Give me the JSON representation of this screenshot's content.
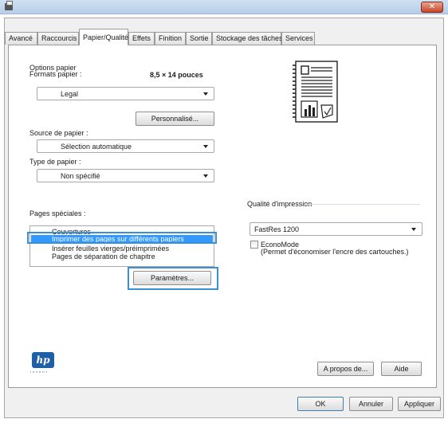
{
  "window": {
    "close_glyph": "✕"
  },
  "tabs": [
    {
      "label": "Avancé"
    },
    {
      "label": "Raccourcis"
    },
    {
      "label": "Papier/Qualité"
    },
    {
      "label": "Effets"
    },
    {
      "label": "Finition"
    },
    {
      "label": "Sortie"
    },
    {
      "label": "Stockage des tâches"
    },
    {
      "label": "Services"
    }
  ],
  "paper": {
    "group_label": "Options papier",
    "formats_label": "Formats papier :",
    "size_value": "8,5 × 14 pouces",
    "format_selected": "Legal",
    "custom_button": "Personnalisé...",
    "source_label": "Source de papier :",
    "source_selected": "Sélection automatique",
    "type_label": "Type de papier :",
    "type_selected": "Non spécifié"
  },
  "special_pages": {
    "label": "Pages spéciales :",
    "items": [
      "Couvertures",
      "Imprimer des pages sur différents papiers",
      "Insérer feuilles vierges/préimprimées",
      "Pages de séparation de chapitre"
    ],
    "selected_index": 1,
    "settings_button": "Paramètres..."
  },
  "quality": {
    "group_label": "Qualité d'impression",
    "selected": "FastRes 1200",
    "economode_label": "EconoMode",
    "economode_hint": "(Permet d'économiser l'encre des cartouches.)"
  },
  "footer": {
    "hp_logo": "hp",
    "hp_tagline": "invent",
    "about_button": "A propos de...",
    "help_button": "Aide",
    "ok_button": "OK",
    "cancel_button": "Annuler",
    "apply_button": "Appliquer"
  },
  "colors": {
    "selection": "#3399ff",
    "highlight_border": "#3e8fd2",
    "close_red": "#c64526"
  }
}
